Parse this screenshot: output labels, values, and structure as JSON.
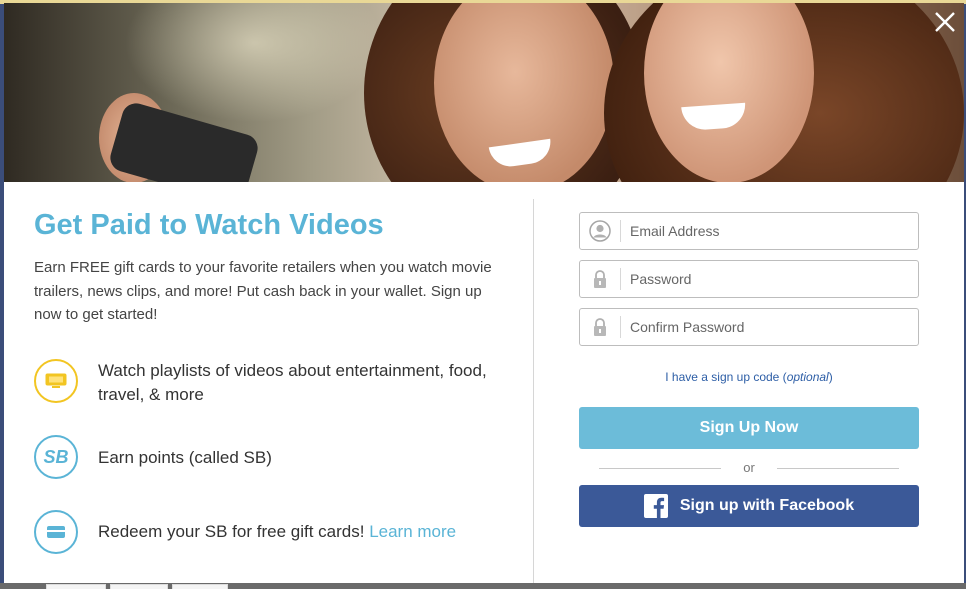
{
  "hero": {
    "close_label": "×"
  },
  "left": {
    "title": "Get Paid to Watch Videos",
    "intro": "Earn FREE gift cards to your favorite retailers when you watch movie trailers, news clips, and more! Put cash back in your wallet. Sign up now to get started!",
    "features": [
      {
        "icon": "tv-icon",
        "text": "Watch playlists of videos about entertainment, food, travel, & more",
        "color": "#f2c522"
      },
      {
        "icon": "sb-icon",
        "text": "Earn points (called SB)",
        "icon_text": "SB",
        "color": "#5ab4d6"
      },
      {
        "icon": "gift-card-icon",
        "text": "Redeem your SB for free gift cards!",
        "link": "Learn more",
        "color": "#5ab4d6"
      }
    ]
  },
  "form": {
    "email_placeholder": "Email Address",
    "password_placeholder": "Password",
    "confirm_placeholder": "Confirm Password",
    "signup_code_text": "I have a sign up code (",
    "signup_code_optional": "optional",
    "signup_code_close": ")",
    "signup_button": "Sign Up Now",
    "or_text": "or",
    "facebook_button": "Sign up with Facebook"
  },
  "colors": {
    "accent": "#5ab4d6",
    "signup_button": "#6cbcd9",
    "facebook": "#3b5998",
    "tv_icon": "#f2c522"
  }
}
